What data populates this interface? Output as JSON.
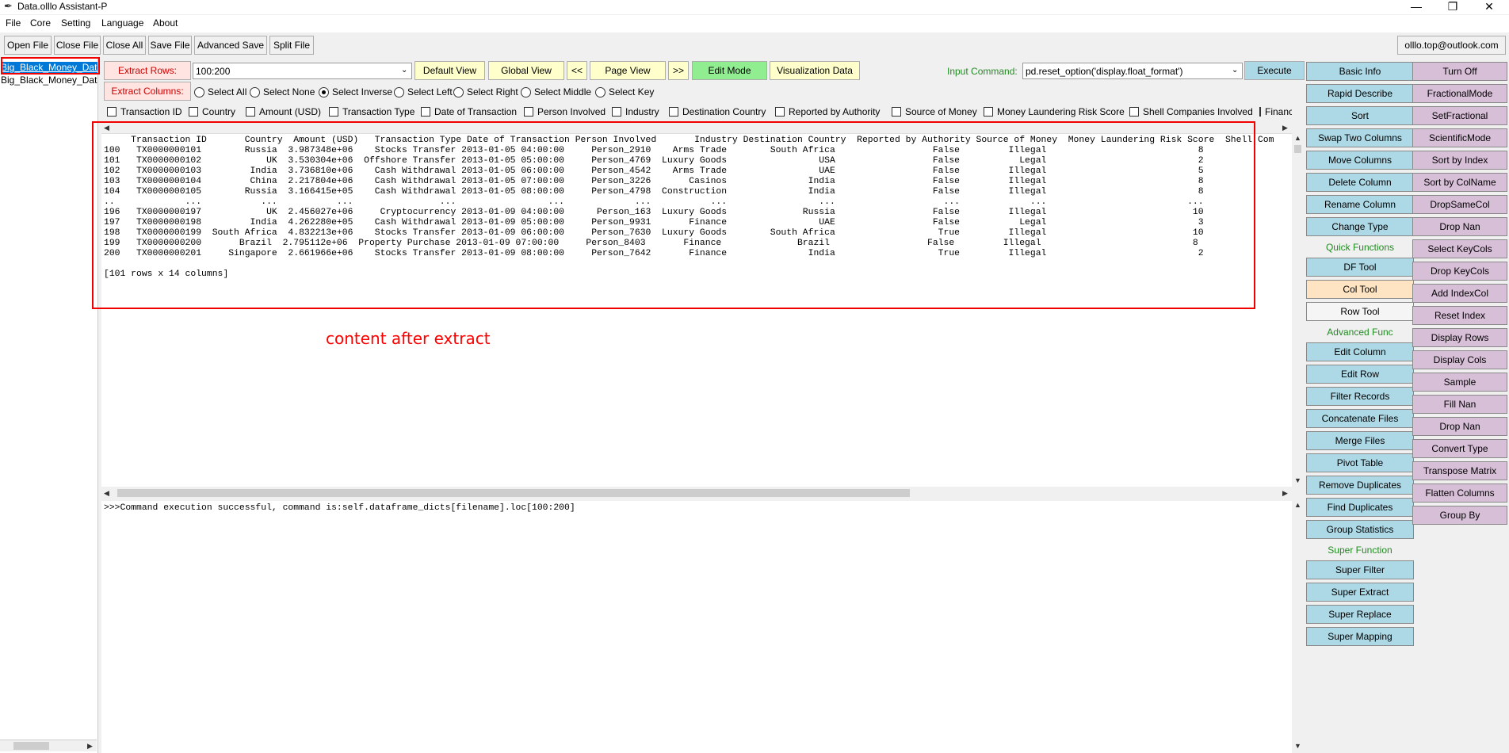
{
  "title": "Data.olllo Assistant-P",
  "window_controls": {
    "min": "—",
    "max": "❐",
    "close": "✕"
  },
  "menu": [
    "File",
    "Core",
    "Setting",
    "Language",
    "About"
  ],
  "toolbar": [
    "Open File",
    "Close File",
    "Close All",
    "Save File",
    "Advanced Save",
    "Split File"
  ],
  "email": "olllo.top@outlook.com",
  "files": [
    "Big_Black_Money_Data",
    "Big_Black_Money_Data"
  ],
  "extract_rows_label": "Extract Rows:",
  "extract_rows_value": "100:200",
  "view_buttons": [
    "Default View",
    "Global View",
    "<<",
    "Page View",
    ">>",
    "Edit Mode",
    "Visualization Data"
  ],
  "input_command_label": "Input Command:",
  "input_command_value": "pd.reset_option('display.float_format')",
  "execute": "Execute",
  "extract_columns_label": "Extract Columns:",
  "radios": [
    {
      "label": "Select All",
      "on": false
    },
    {
      "label": "Select None",
      "on": false
    },
    {
      "label": "Select Inverse",
      "on": true
    },
    {
      "label": "Select Left",
      "on": false
    },
    {
      "label": "Select Right",
      "on": false
    },
    {
      "label": "Select Middle",
      "on": false
    },
    {
      "label": "Select Key",
      "on": false
    }
  ],
  "columns": [
    "Transaction ID",
    "Country",
    "Amount (USD)",
    "Transaction Type",
    "Date of Transaction",
    "Person Involved",
    "Industry",
    "Destination Country",
    "Reported by Authority",
    "Source of Money",
    "Money Laundering Risk Score",
    "Shell Companies Involved",
    "Financi"
  ],
  "table_text": "     Transaction ID       Country  Amount (USD)   Transaction Type Date of Transaction Person Involved       Industry Destination Country  Reported by Authority Source of Money  Money Laundering Risk Score  Shell Com\n100   TX0000000101        Russia  3.987348e+06    Stocks Transfer 2013-01-05 04:00:00     Person_2910    Arms Trade        South Africa                  False         Illegal                            8\n101   TX0000000102            UK  3.530304e+06  Offshore Transfer 2013-01-05 05:00:00     Person_4769  Luxury Goods                 USA                  False           Legal                            2\n102   TX0000000103         India  3.736810e+06    Cash Withdrawal 2013-01-05 06:00:00     Person_4542    Arms Trade                 UAE                  False         Illegal                            5\n103   TX0000000104         China  2.217804e+06    Cash Withdrawal 2013-01-05 07:00:00     Person_3226       Casinos               India                  False         Illegal                            8\n104   TX0000000105        Russia  3.166415e+05    Cash Withdrawal 2013-01-05 08:00:00     Person_4798  Construction               India                  False         Illegal                            8\n..             ...           ...           ...                ...                 ...             ...           ...                 ...                    ...             ...                          ...\n196   TX0000000197            UK  2.456027e+06     Cryptocurrency 2013-01-09 04:00:00      Person_163  Luxury Goods              Russia                  False         Illegal                           10\n197   TX0000000198         India  4.262280e+05    Cash Withdrawal 2013-01-09 05:00:00     Person_9931       Finance                 UAE                  False           Legal                            3\n198   TX0000000199  South Africa  4.832213e+06    Stocks Transfer 2013-01-09 06:00:00     Person_7630  Luxury Goods        South Africa                   True         Illegal                           10\n199   TX0000000200       Brazil  2.795112e+06  Property Purchase 2013-01-09 07:00:00     Person_8403       Finance              Brazil                  False         Illegal                            8\n200   TX0000000201     Singapore  2.661966e+06    Stocks Transfer 2013-01-09 08:00:00     Person_7642       Finance               India                   True         Illegal                            2\n\n[101 rows x 14 columns]",
  "annotation": "content after extract",
  "output_text": ">>>Command execution successful, command is:self.dataframe_dicts[filename].loc[100:200]",
  "right_col1": {
    "top": [
      "Basic Info",
      "Rapid Describe",
      "Sort",
      "Swap Two Columns",
      "Move Columns",
      "Delete Column",
      "Rename Column",
      "Change Type"
    ],
    "quick_label": "Quick Functions",
    "quick": [
      "DF Tool",
      "Col Tool",
      "Row Tool"
    ],
    "adv_label": "Advanced Func",
    "adv": [
      "Edit Column",
      "Edit Row",
      "Filter Records",
      "Concatenate Files",
      "Merge Files",
      "Pivot Table",
      "Remove Duplicates",
      "Find Duplicates",
      "Group Statistics"
    ],
    "super_label": "Super Function",
    "super": [
      "Super Filter",
      "Super Extract",
      "Super Replace",
      "Super Mapping"
    ]
  },
  "right_col2": [
    "Turn Off",
    "FractionalMode",
    "SetFractional",
    "ScientificMode",
    "Sort by Index",
    "Sort by ColName",
    "DropSameCol",
    "Drop Nan",
    "Select KeyCols",
    "Drop KeyCols",
    "Add IndexCol",
    "Reset Index",
    "Display Rows",
    "Display Cols",
    "Sample",
    "Fill Nan",
    "Drop Nan",
    "Convert Type",
    "Transpose Matrix",
    "Flatten Columns",
    "Group By"
  ],
  "colors": {
    "blue_btn": "#add8e6",
    "purple_btn": "#d8bfd8",
    "yellow_btn": "#ffffcc",
    "green_btn": "#90ee90",
    "red_annotation": "#f20000",
    "section_green": "#228b22"
  }
}
